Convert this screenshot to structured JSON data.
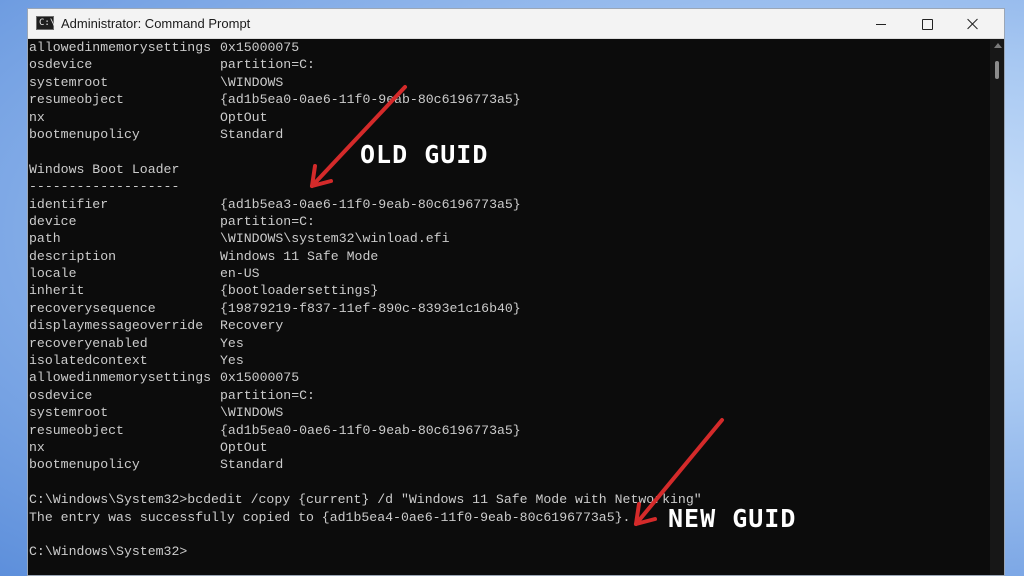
{
  "window": {
    "title": "Administrator: Command Prompt",
    "icon": "command-prompt-icon",
    "icon_glyph": "C:\\_"
  },
  "console": {
    "lines": [
      {
        "name": "allowedinmemorysettings",
        "value": "0x15000075"
      },
      {
        "name": "osdevice",
        "value": "partition=C:"
      },
      {
        "name": "systemroot",
        "value": "\\WINDOWS"
      },
      {
        "name": "resumeobject",
        "value": "{ad1b5ea0-0ae6-11f0-9eab-80c6196773a5}"
      },
      {
        "name": "nx",
        "value": "OptOut"
      },
      {
        "name": "bootmenupolicy",
        "value": "Standard"
      },
      {
        "text": ""
      },
      {
        "text": "Windows Boot Loader"
      },
      {
        "text": "-------------------"
      },
      {
        "name": "identifier",
        "value": "{ad1b5ea3-0ae6-11f0-9eab-80c6196773a5}"
      },
      {
        "name": "device",
        "value": "partition=C:"
      },
      {
        "name": "path",
        "value": "\\WINDOWS\\system32\\winload.efi"
      },
      {
        "name": "description",
        "value": "Windows 11 Safe Mode"
      },
      {
        "name": "locale",
        "value": "en-US"
      },
      {
        "name": "inherit",
        "value": "{bootloadersettings}"
      },
      {
        "name": "recoverysequence",
        "value": "{19879219-f837-11ef-890c-8393e1c16b40}"
      },
      {
        "name": "displaymessageoverride",
        "value": "Recovery"
      },
      {
        "name": "recoveryenabled",
        "value": "Yes"
      },
      {
        "name": "isolatedcontext",
        "value": "Yes"
      },
      {
        "name": "allowedinmemorysettings",
        "value": "0x15000075"
      },
      {
        "name": "osdevice",
        "value": "partition=C:"
      },
      {
        "name": "systemroot",
        "value": "\\WINDOWS"
      },
      {
        "name": "resumeobject",
        "value": "{ad1b5ea0-0ae6-11f0-9eab-80c6196773a5}"
      },
      {
        "name": "nx",
        "value": "OptOut"
      },
      {
        "name": "bootmenupolicy",
        "value": "Standard"
      },
      {
        "text": ""
      },
      {
        "text": "C:\\Windows\\System32>bcdedit /copy {current} /d \"Windows 11 Safe Mode with Networking\""
      },
      {
        "text": "The entry was successfully copied to {ad1b5ea4-0ae6-11f0-9eab-80c6196773a5}."
      },
      {
        "text": ""
      },
      {
        "text": "C:\\Windows\\System32>"
      }
    ]
  },
  "annotations": {
    "old_guid_label": "OLD GUID",
    "new_guid_label": "NEW GUID",
    "arrow_color": "#d42a2a",
    "label_color": "#ffffff"
  },
  "colors": {
    "console_bg": "#0c0c0c",
    "console_text": "#cccccc",
    "titlebar_bg": "#f3f3f3"
  }
}
